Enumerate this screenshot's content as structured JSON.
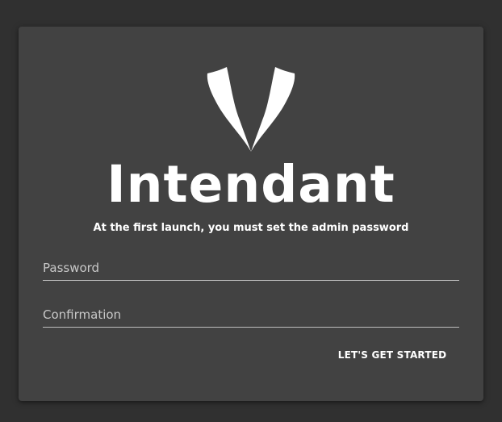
{
  "app": {
    "title": "Intendant",
    "subtitle": "At the first launch, you must set the admin password"
  },
  "form": {
    "password": {
      "placeholder": "Password",
      "value": ""
    },
    "confirmation": {
      "placeholder": "Confirmation",
      "value": ""
    },
    "submit_label": "LET'S GET STARTED"
  },
  "icons": {
    "logo": "lapels-logo-icon"
  },
  "colors": {
    "background": "#303030",
    "card": "#424242",
    "text": "#ffffff",
    "underline": "#bdbdbd"
  }
}
